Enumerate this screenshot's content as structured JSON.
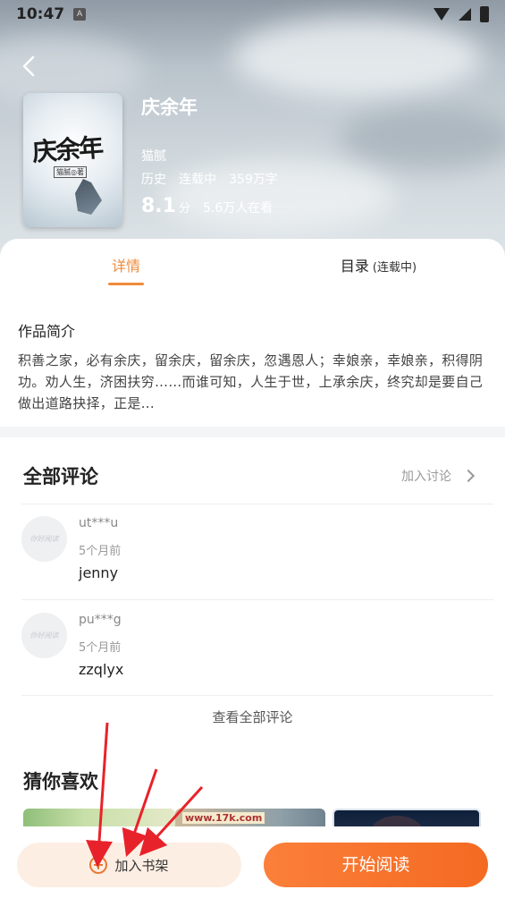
{
  "status_bar": {
    "time": "10:47",
    "notif_icon": "A"
  },
  "book": {
    "title": "庆余年",
    "cover_title": "庆余年",
    "cover_author": "猫腻◎著",
    "author": "猫腻",
    "category": "历史",
    "status": "连载中",
    "word_count": "359万字",
    "score": "8.1",
    "score_unit": "分",
    "readers": "5.6万人在看"
  },
  "tabs": {
    "detail": "详情",
    "toc": "目录",
    "toc_status": "(连载中)"
  },
  "intro": {
    "heading": "作品简介",
    "text": "积善之家，必有余庆，留余庆，留余庆，忽遇恩人；幸娘亲，幸娘亲，积得阴功。劝人生，济困扶穷……而谁可知，人生于世，上承余庆，终究却是要自己做出道路抉择，正是..."
  },
  "comments": {
    "heading": "全部评论",
    "join": "加入讨论",
    "items": [
      {
        "avatar_text": "你好阅读",
        "user": "ut***u",
        "time": "5个月前",
        "text": "jenny"
      },
      {
        "avatar_text": "你好阅读",
        "user": "pu***g",
        "time": "5个月前",
        "text": "zzqlyx"
      }
    ],
    "view_all": "查看全部评论"
  },
  "guess": {
    "heading": "猜你喜欢",
    "items": [
      {
        "label": ""
      },
      {
        "label": "www.17k.com"
      },
      {
        "label": ""
      }
    ]
  },
  "bottom_bar": {
    "add_shelf": "加入书架",
    "start_reading": "开始阅读"
  },
  "colors": {
    "accent": "#f08a3c",
    "button_gradient_start": "#fb7f3a",
    "button_gradient_end": "#f46a22",
    "annotation": "#e8222a"
  }
}
